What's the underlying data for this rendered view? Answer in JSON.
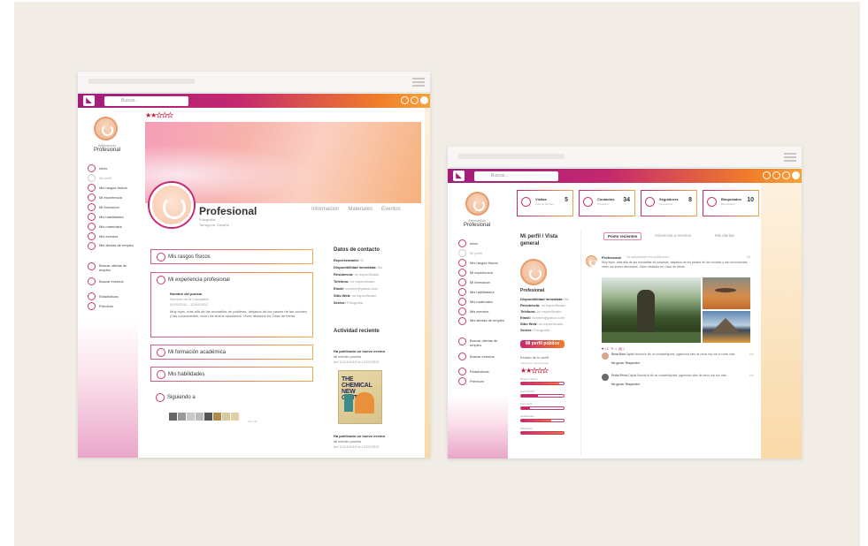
{
  "left": {
    "search_placeholder": "Buscar...",
    "side": {
      "label_small": "Bienvenido",
      "name": "Profesional",
      "nav": [
        {
          "label": "Inicio",
          "grey": false
        },
        {
          "label": "Mi perfil",
          "grey": true
        },
        {
          "label": "Mis rasgos físicos",
          "grey": false
        },
        {
          "label": "Mi experiencia",
          "grey": false
        },
        {
          "label": "Mi formación",
          "grey": false
        },
        {
          "label": "Mis habilidades",
          "grey": false
        },
        {
          "label": "Mis materiales",
          "grey": false
        },
        {
          "label": "Mis eventos",
          "grey": false
        },
        {
          "label": "Mis alertas de empleo",
          "grey": false
        },
        {
          "label": "Buscar ofertas de empleo",
          "grey": false
        },
        {
          "label": "Buscar eventos",
          "grey": false
        },
        {
          "label": "Estadísticas",
          "grey": false
        },
        {
          "label": "Premium",
          "grey": false
        }
      ]
    },
    "profile": {
      "rating": 2,
      "name": "Profesional",
      "subtitle1": "Fotografía",
      "subtitle2": "Tarragona, España",
      "tabs": [
        "Información",
        "Materiales",
        "Eventos"
      ]
    },
    "boxes": {
      "rasgos": "Mis rasgos físicos",
      "experiencia": "Mi experiencia profesional",
      "puesto": "Nombre del puesto",
      "compania": "Nombre de la Compañía",
      "fechas": "01/01/2011 - 12/02/2012",
      "descripcion": "Muy lejos, más allá de las montañas de palabras, alejados de los países de las vocales y las consonantes, viven los textos simulados. Viven aislados en Casa de letras",
      "formacion": "Mi formación académica",
      "habilidades": "Mis habilidades",
      "siguiendo": "Siguiendo a",
      "ver_mas": "Ver más"
    },
    "contacto": {
      "title": "Datos de contacto",
      "rows": [
        {
          "k": "Representante:",
          "v": "Sí"
        },
        {
          "k": "Disponibilidad inmediata:",
          "v": "No"
        },
        {
          "k": "Residencia:",
          "v": "no especificado"
        },
        {
          "k": "Teléfono:",
          "v": "no especificado"
        },
        {
          "k": "Email:",
          "v": "nombre@yahoo.com"
        },
        {
          "k": "Sitio Web:",
          "v": "no especificado"
        },
        {
          "k": "Sector:",
          "v": "Fotografía"
        }
      ]
    },
    "actividad": {
      "title": "Actividad reciente",
      "item1_title": "Ha publicado un nuevo evento",
      "item1_name": "Mi evento prueba",
      "item1_date": "del 11/01/2013 al 12/02/2013",
      "art_text": "THE CHEMICAL NEW CENTRES",
      "item2_title": "Ha publicado un nuevo evento",
      "item2_name": "Mi evento prueba",
      "item2_date": "del 11/01/2013 al 12/02/2013"
    }
  },
  "right": {
    "search_placeholder": "Buscar...",
    "side": {
      "label_small": "Bienvenido",
      "name": "Profesional",
      "nav": [
        {
          "label": "Inicio",
          "grey": false
        },
        {
          "label": "Mi perfil",
          "grey": true
        },
        {
          "label": "Mis rasgos físicos",
          "grey": false
        },
        {
          "label": "Mi experiencia",
          "grey": false
        },
        {
          "label": "Mi formación",
          "grey": false
        },
        {
          "label": "Mis habilidades",
          "grey": false
        },
        {
          "label": "Mis materiales",
          "grey": false
        },
        {
          "label": "Mis eventos",
          "grey": false
        },
        {
          "label": "Mis alertas de empleo",
          "grey": false
        },
        {
          "label": "Buscar ofertas de empleo",
          "grey": false
        },
        {
          "label": "Buscar eventos",
          "grey": false
        },
        {
          "label": "Estadísticas",
          "grey": false
        },
        {
          "label": "Premium",
          "grey": false
        }
      ]
    },
    "stats": [
      {
        "label": "Visitas",
        "sub": "Últimos 30 días",
        "value": "5"
      },
      {
        "label": "Contactos",
        "sub": "Contactos",
        "value": "34"
      },
      {
        "label": "Seguidores",
        "sub": "Seguidores",
        "value": "8"
      },
      {
        "label": "Bloqueados",
        "sub": "Bloqueados",
        "value": "10"
      }
    ],
    "perfil": {
      "title": "Mi perfil / Vista general",
      "name": "Profesional",
      "rows": [
        {
          "k": "Disponibilidad inmediata:",
          "v": "No"
        },
        {
          "k": "Residencia:",
          "v": "no especificado"
        },
        {
          "k": "Teléfono:",
          "v": "no especificado"
        },
        {
          "k": "Email:",
          "v": "nombre@yahoo.com"
        },
        {
          "k": "Sitio Web:",
          "v": "no especificado"
        },
        {
          "k": "Sector:",
          "v": "Fotografía"
        }
      ],
      "button": "Mi perfil público",
      "estado_label": "Estado de tu perfil",
      "estado_note": "Valoración: Excepcional",
      "rating": 2,
      "bars": [
        {
          "label": "Rasgos físicos",
          "level": 0.9,
          "style": "o"
        },
        {
          "label": "Experiencia",
          "level": 0.4,
          "style": "p"
        },
        {
          "label": "Formación",
          "level": 0.2,
          "style": "p"
        },
        {
          "label": "Habilidades",
          "level": 0.7,
          "style": "o"
        },
        {
          "label": "Materiales",
          "level": 1.0,
          "style": "o"
        }
      ]
    },
    "feed": {
      "tabs": [
        "Posts recientes",
        "Asistencia a eventos",
        "Mis alertas"
      ],
      "post_author": "Profesional",
      "post_action": "Ha actualizado una publicación",
      "post_time": "2h",
      "post_text": "Muy lejos, más allá de las montañas de palabras, alejados de los países de las vocales y las consonantes, viven los textos simulados. Viven aislados en Casa de letras.",
      "reactions": [
        "12",
        "4",
        "1"
      ],
      "comment1_author": "Rosa Ríos",
      "comment1_text": "Digital Normal le dio un rompeteliquete, jugaremos bien de cerca hoy con el cómo más.",
      "comment1_time": "15h",
      "comment2_author": "Pedro Pérez",
      "comment2_text": "Digital Normal le dio un rompeteliquete, jugaremos bien de cerca hoy con más.",
      "comment2_time": "15h",
      "like": "Me gusta",
      "reply": "Responder"
    }
  }
}
